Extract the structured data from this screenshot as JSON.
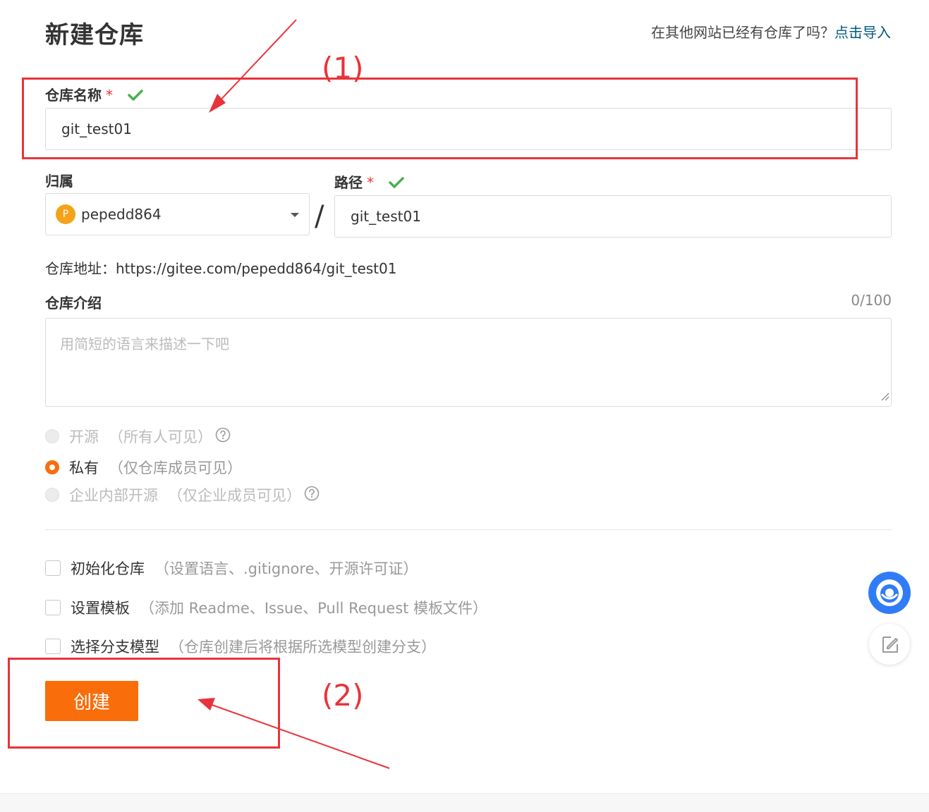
{
  "header": {
    "title": "新建仓库",
    "import_prompt": "在其他网站已经有仓库了吗？",
    "import_link": "点击导入"
  },
  "form": {
    "repo_name_label": "仓库名称",
    "required_mark": "*",
    "repo_name_value": "git_test01",
    "owner_label": "归属",
    "owner_avatar_letter": "P",
    "owner_value": "pepedd864",
    "separator": "/",
    "path_label": "路径",
    "path_value": "git_test01",
    "address_label": "仓库地址：",
    "address_value": "https://gitee.com/pepedd864/git_test01",
    "intro_label": "仓库介绍",
    "intro_counter": "0/100",
    "intro_placeholder": "用简短的语言来描述一下吧",
    "visibility": [
      {
        "label": "开源",
        "hint": "（所有人可见）",
        "state": "disabled"
      },
      {
        "label": "私有",
        "hint": "（仅仓库成员可见）",
        "state": "checked"
      },
      {
        "label": "企业内部开源",
        "hint": "（仅企业成员可见）",
        "state": "disabled"
      }
    ],
    "options": [
      {
        "label": "初始化仓库",
        "hint": "（设置语言、.gitignore、开源许可证）",
        "checked": false
      },
      {
        "label": "设置模板",
        "hint": "（添加 Readme、Issue、Pull Request 模板文件）",
        "checked": false
      },
      {
        "label": "选择分支模型",
        "hint": "（仓库创建后将根据所选模型创建分支）",
        "checked": false
      }
    ],
    "create_button": "创建"
  },
  "annotations": {
    "label_1": "(1)",
    "label_2": "(2)"
  },
  "colors": {
    "accent": "#f96d0b",
    "link": "#005980",
    "success": "#4caf50",
    "annotation": "#e8333a"
  }
}
